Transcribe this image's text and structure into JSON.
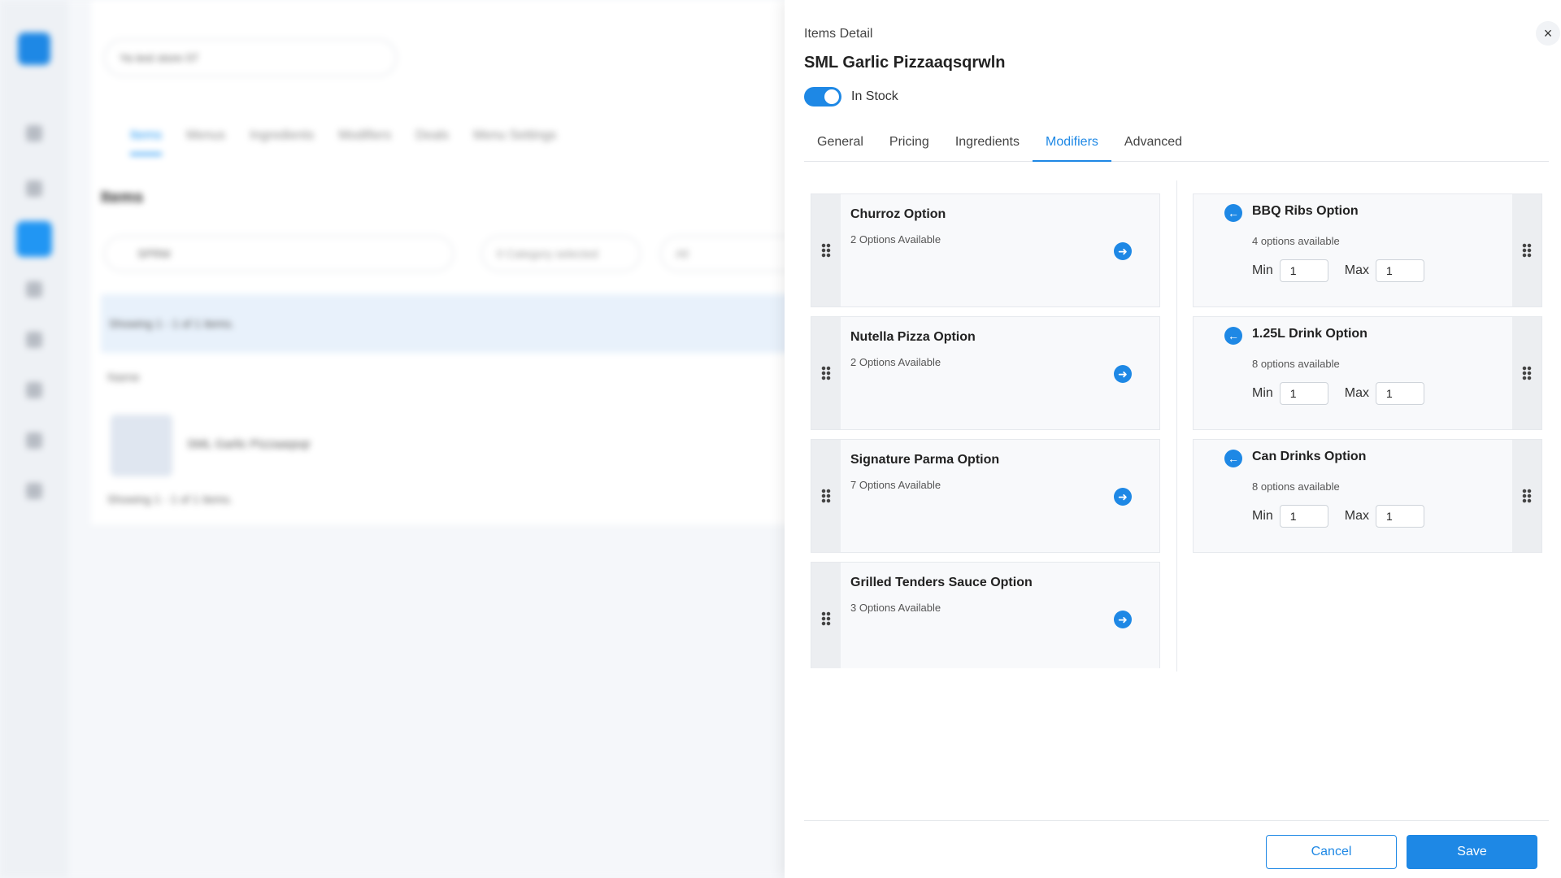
{
  "background": {
    "store_select": "Ya test store 07",
    "tabs": [
      "Items",
      "Menus",
      "Ingredients",
      "Modifiers",
      "Deals",
      "Menu Settings"
    ],
    "page_title": "Items",
    "search_value": "SPRM",
    "category_filter": "0 Category selected",
    "status_filter": "All",
    "showing_text": "Showing 1 - 1 of 1 items.",
    "column_name": "Name",
    "item_name": "SML Garlic Pizzaaqsqr",
    "showing_text_bottom": "Showing 1 - 1 of 1 items."
  },
  "drawer": {
    "label": "Items Detail",
    "close_icon": "×",
    "item_title": "SML Garlic Pizzaaqsqrwln",
    "in_stock_label": "In Stock",
    "in_stock": true,
    "tabs": [
      {
        "label": "General"
      },
      {
        "label": "Pricing"
      },
      {
        "label": "Ingredients"
      },
      {
        "label": "Modifiers"
      },
      {
        "label": "Advanced"
      }
    ],
    "active_tab": "Modifiers",
    "available_modifiers": [
      {
        "name": "Churroz Option",
        "count": "2 Options Available"
      },
      {
        "name": "Nutella Pizza Option",
        "count": "2 Options Available"
      },
      {
        "name": "Signature Parma Option",
        "count": "7 Options Available"
      },
      {
        "name": "Grilled Tenders Sauce Option",
        "count": "3 Options Available"
      }
    ],
    "assigned_modifiers": [
      {
        "name": "BBQ Ribs Option",
        "count": "4 options available",
        "min_label": "Min",
        "min": "1",
        "max_label": "Max",
        "max": "1"
      },
      {
        "name": "1.25L Drink Option",
        "count": "8 options available",
        "min_label": "Min",
        "min": "1",
        "max_label": "Max",
        "max": "1"
      },
      {
        "name": "Can Drinks Option",
        "count": "8 options available",
        "min_label": "Min",
        "min": "1",
        "max_label": "Max",
        "max": "1"
      }
    ],
    "add_arrow": "➜",
    "remove_arrow": "←",
    "cancel_label": "Cancel",
    "save_label": "Save"
  },
  "colors": {
    "accent": "#1e88e5",
    "card_bg": "#f8f9fb",
    "handle_bg": "#eceef1"
  }
}
